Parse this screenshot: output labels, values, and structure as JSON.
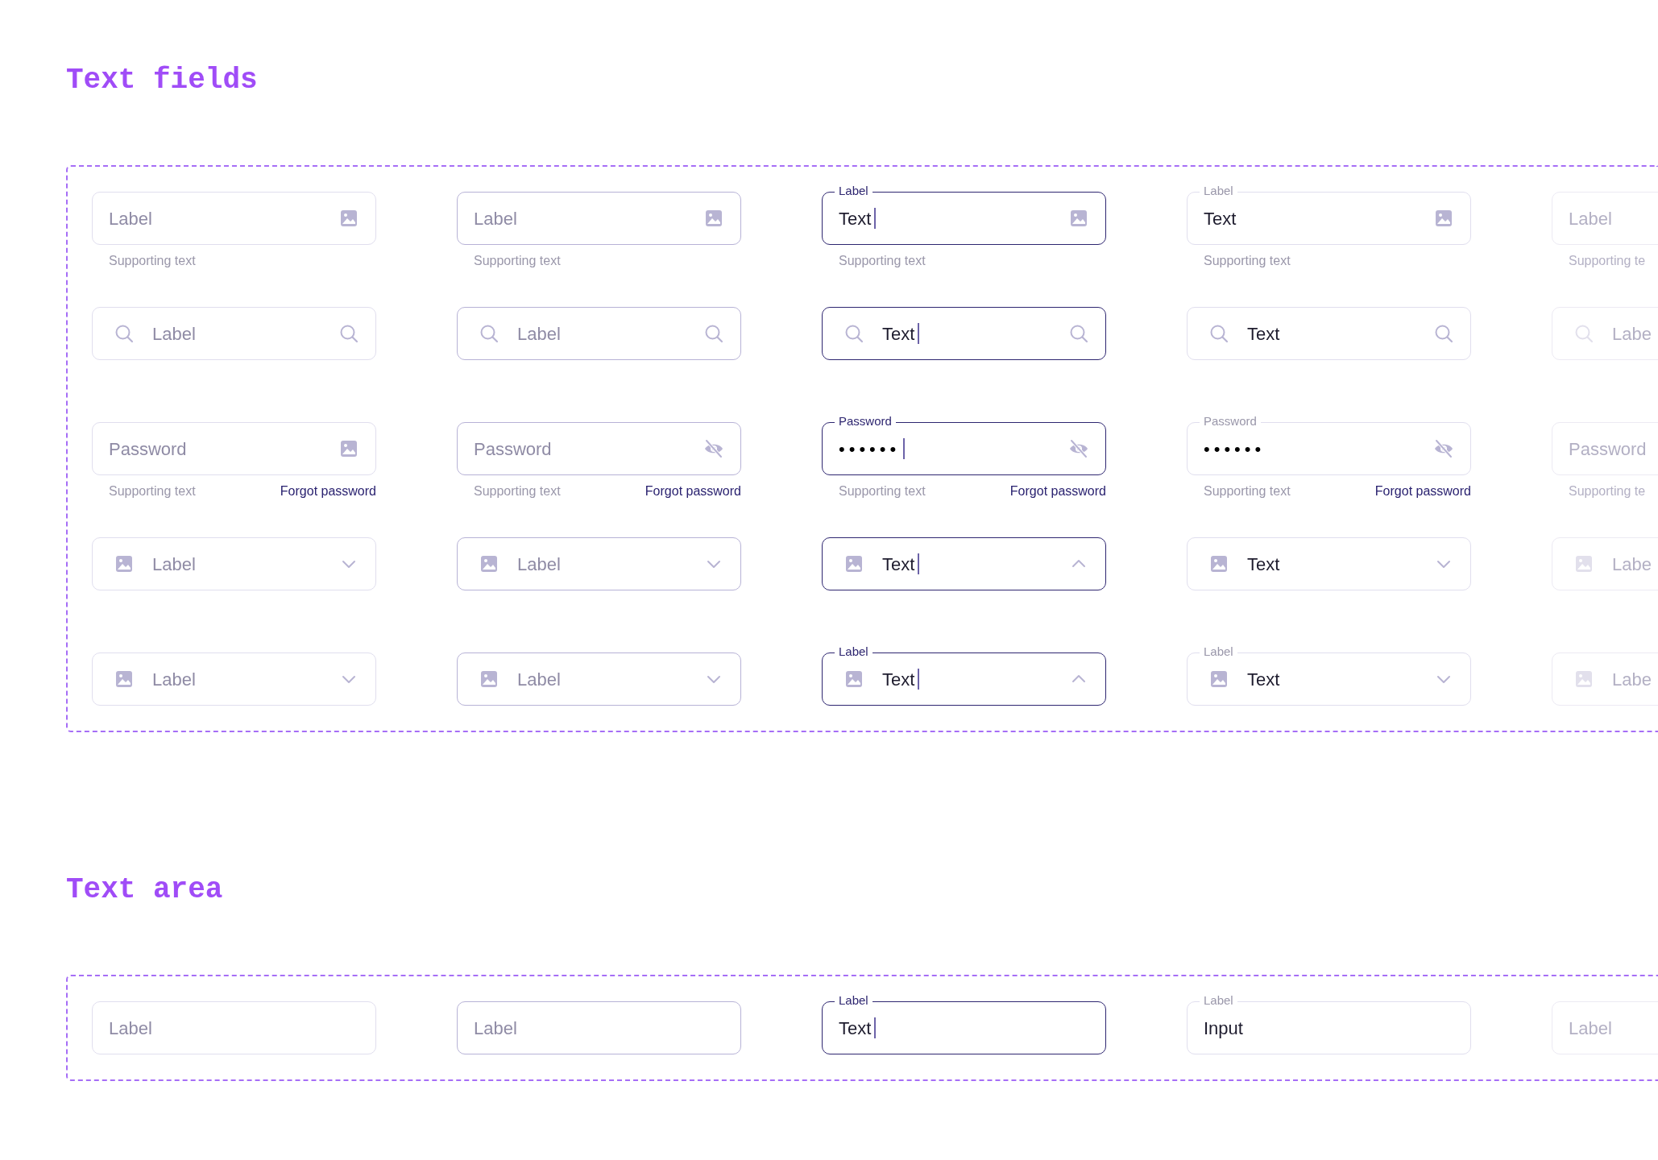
{
  "sections": [
    {
      "title": "Text fields",
      "rows": [
        {
          "kind": "text",
          "fields": [
            {
              "hovered": false,
              "focused": false,
              "disabled": false,
              "placeholder": "Label",
              "trailing_icon": true,
              "supporting_text": "Supporting text"
            },
            {
              "hovered": true,
              "focused": false,
              "disabled": false,
              "placeholder": "Label",
              "trailing_icon": true,
              "supporting_text": "Supporting text"
            },
            {
              "hovered": false,
              "focused": true,
              "disabled": false,
              "label": "Label",
              "value": "Text",
              "trailing_icon": true,
              "supporting_text": "Supporting text"
            },
            {
              "hovered": false,
              "focused": false,
              "disabled": false,
              "label": "Label",
              "value": "Text",
              "trailing_icon": true,
              "supporting_text": "Supporting text"
            },
            {
              "hovered": false,
              "focused": false,
              "disabled": true,
              "placeholder": "Label",
              "trailing_icon": false,
              "supporting_text": "Supporting te"
            }
          ]
        },
        {
          "kind": "search",
          "fields": [
            {
              "hovered": false,
              "focused": false,
              "disabled": false,
              "placeholder": "Label",
              "trailing_icon": true
            },
            {
              "hovered": true,
              "focused": false,
              "disabled": false,
              "placeholder": "Label",
              "trailing_icon": true
            },
            {
              "hovered": false,
              "focused": true,
              "disabled": false,
              "value": "Text",
              "trailing_icon": true
            },
            {
              "hovered": false,
              "focused": false,
              "disabled": false,
              "value": "Text",
              "trailing_icon": true
            },
            {
              "hovered": false,
              "focused": false,
              "disabled": true,
              "placeholder": "Labe",
              "trailing_icon": false
            }
          ]
        },
        {
          "kind": "password",
          "fields": [
            {
              "hovered": false,
              "focused": false,
              "disabled": false,
              "placeholder": "Password",
              "trailing_icon": true,
              "visibility_toggle": false,
              "supporting_text": "Supporting text",
              "link": "Forgot password"
            },
            {
              "hovered": true,
              "focused": false,
              "disabled": false,
              "placeholder": "Password",
              "trailing_icon": true,
              "visibility_toggle": true,
              "supporting_text": "Supporting text",
              "link": "Forgot password"
            },
            {
              "hovered": false,
              "focused": true,
              "disabled": false,
              "label": "Password",
              "value": "••••••",
              "trailing_icon": true,
              "visibility_toggle": true,
              "supporting_text": "Supporting text",
              "link": "Forgot password"
            },
            {
              "hovered": false,
              "focused": false,
              "disabled": false,
              "label": "Password",
              "value": "••••••",
              "trailing_icon": true,
              "visibility_toggle": true,
              "supporting_text": "Supporting text",
              "link": "Forgot password"
            },
            {
              "hovered": false,
              "focused": false,
              "disabled": true,
              "placeholder": "Password",
              "trailing_icon": false,
              "supporting_text": "Supporting te"
            }
          ]
        },
        {
          "kind": "select",
          "fields": [
            {
              "hovered": false,
              "focused": false,
              "disabled": false,
              "placeholder": "Label",
              "trailing_icon": true,
              "expanded": false
            },
            {
              "hovered": true,
              "focused": false,
              "disabled": false,
              "placeholder": "Label",
              "trailing_icon": true,
              "expanded": false
            },
            {
              "hovered": false,
              "focused": true,
              "disabled": false,
              "value": "Text",
              "trailing_icon": true,
              "expanded": true
            },
            {
              "hovered": false,
              "focused": false,
              "disabled": false,
              "value": "Text",
              "trailing_icon": true,
              "expanded": false
            },
            {
              "hovered": false,
              "focused": false,
              "disabled": true,
              "placeholder": "Labe",
              "trailing_icon": false
            }
          ]
        },
        {
          "kind": "select",
          "fields": [
            {
              "hovered": false,
              "focused": false,
              "disabled": false,
              "placeholder": "Label",
              "trailing_icon": true,
              "expanded": false
            },
            {
              "hovered": true,
              "focused": false,
              "disabled": false,
              "placeholder": "Label",
              "trailing_icon": true,
              "expanded": false
            },
            {
              "hovered": false,
              "focused": true,
              "disabled": false,
              "label": "Label",
              "value": "Text",
              "trailing_icon": true,
              "expanded": true
            },
            {
              "hovered": false,
              "focused": false,
              "disabled": false,
              "label": "Label",
              "value": "Text",
              "trailing_icon": true,
              "expanded": false
            },
            {
              "hovered": false,
              "focused": false,
              "disabled": true,
              "placeholder": "Labe",
              "trailing_icon": false
            }
          ]
        }
      ]
    },
    {
      "title": "Text area",
      "rows": [
        {
          "kind": "textarea",
          "fields": [
            {
              "hovered": false,
              "focused": false,
              "disabled": false,
              "placeholder": "Label"
            },
            {
              "hovered": true,
              "focused": false,
              "disabled": false,
              "placeholder": "Label"
            },
            {
              "hovered": false,
              "focused": true,
              "disabled": false,
              "label": "Label",
              "value": "Text"
            },
            {
              "hovered": false,
              "focused": false,
              "disabled": false,
              "label": "Label",
              "value": "Input"
            },
            {
              "hovered": false,
              "focused": false,
              "disabled": true,
              "placeholder": "Label"
            }
          ]
        }
      ]
    }
  ]
}
